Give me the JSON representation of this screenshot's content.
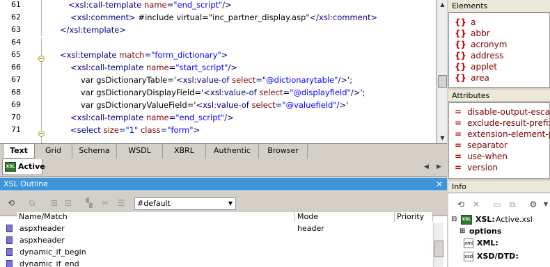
{
  "editor": {
    "lines": [
      {
        "num": "61",
        "parts": [
          {
            "c": "tg",
            "t": "<xsl:call-template "
          },
          {
            "c": "at",
            "t": "name"
          },
          {
            "c": "tg",
            "t": "="
          },
          {
            "c": "vl",
            "t": "\"end_script\""
          },
          {
            "c": "tg",
            "t": "/>"
          }
        ]
      },
      {
        "num": "62",
        "parts": [
          {
            "c": "tg",
            "t": "<xsl:comment>"
          },
          {
            "c": "tx",
            "t": " #include virtual=\"inc_partner_display.asp\""
          },
          {
            "c": "tg",
            "t": "</xsl:comment>"
          }
        ]
      },
      {
        "num": "63",
        "parts": [
          {
            "c": "tg",
            "t": "</xsl:template>"
          }
        ]
      },
      {
        "num": "64",
        "parts": []
      },
      {
        "num": "65",
        "parts": [
          {
            "c": "tg",
            "t": "<xsl:template "
          },
          {
            "c": "at",
            "t": "match"
          },
          {
            "c": "tg",
            "t": "="
          },
          {
            "c": "vl",
            "t": "\"form_dictionary\""
          },
          {
            "c": "tg",
            "t": ">"
          }
        ]
      },
      {
        "num": "66",
        "parts": [
          {
            "c": "tg",
            "t": "<xsl:call-template "
          },
          {
            "c": "at",
            "t": "name"
          },
          {
            "c": "tg",
            "t": "="
          },
          {
            "c": "vl",
            "t": "\"start_script\""
          },
          {
            "c": "tg",
            "t": "/>"
          }
        ]
      },
      {
        "num": "67",
        "parts": [
          {
            "c": "tx",
            "t": "var gsDictionaryTable='"
          },
          {
            "c": "tg",
            "t": "<xsl:value-of "
          },
          {
            "c": "at",
            "t": "select"
          },
          {
            "c": "tg",
            "t": "="
          },
          {
            "c": "vl",
            "t": "\"@dictionarytable\""
          },
          {
            "c": "tg",
            "t": "/>"
          },
          {
            "c": "tx",
            "t": "';"
          }
        ]
      },
      {
        "num": "68",
        "parts": [
          {
            "c": "tx",
            "t": "var gsDictionaryDisplayField='"
          },
          {
            "c": "tg",
            "t": "<xsl:value-of "
          },
          {
            "c": "at",
            "t": "select"
          },
          {
            "c": "tg",
            "t": "="
          },
          {
            "c": "vl",
            "t": "\"@displayfield\""
          },
          {
            "c": "tg",
            "t": "/>"
          },
          {
            "c": "tx",
            "t": "';"
          }
        ]
      },
      {
        "num": "69",
        "parts": [
          {
            "c": "tx",
            "t": "var gsDictionaryValueField='"
          },
          {
            "c": "tg",
            "t": "<xsl:value-of "
          },
          {
            "c": "at",
            "t": "select"
          },
          {
            "c": "tg",
            "t": "="
          },
          {
            "c": "vl",
            "t": "\"@valuefield\""
          },
          {
            "c": "tg",
            "t": "/>"
          },
          {
            "c": "tx",
            "t": "'"
          }
        ]
      },
      {
        "num": "70",
        "parts": [
          {
            "c": "tg",
            "t": "<xsl:call-template "
          },
          {
            "c": "at",
            "t": "name"
          },
          {
            "c": "tg",
            "t": "="
          },
          {
            "c": "vl",
            "t": "\"end_script\""
          },
          {
            "c": "tg",
            "t": "/>"
          }
        ]
      },
      {
        "num": "71",
        "parts": [
          {
            "c": "tg",
            "t": "<select "
          },
          {
            "c": "at",
            "t": "size"
          },
          {
            "c": "tg",
            "t": "="
          },
          {
            "c": "vl",
            "t": "\"1\""
          },
          {
            "c": "tg",
            "t": " "
          },
          {
            "c": "at",
            "t": "class"
          },
          {
            "c": "tg",
            "t": "="
          },
          {
            "c": "vl",
            "t": "\"form\""
          },
          {
            "c": "tg",
            "t": ">"
          }
        ]
      }
    ]
  },
  "view_tabs": [
    "Text",
    "Grid",
    "Schema",
    "WSDL",
    "XBRL",
    "Authentic",
    "Browser"
  ],
  "doc_tab": {
    "label": "Active"
  },
  "outline": {
    "title": "XSL Outline",
    "mode_value": "#default",
    "columns": [
      "Name/Match",
      "Mode",
      "Priority"
    ],
    "rows": [
      {
        "name": "aspxheader",
        "mode": "header"
      },
      {
        "name": "aspxheader",
        "mode": ""
      },
      {
        "name": "dynamic_if_begin",
        "mode": ""
      },
      {
        "name": "dynamic_if_end",
        "mode": ""
      }
    ]
  },
  "elements_panel": {
    "title": "Elements",
    "items": [
      "a",
      "abbr",
      "acronym",
      "address",
      "applet",
      "area"
    ]
  },
  "attributes_panel": {
    "title": "Attributes",
    "items": [
      "disable-output-escap",
      "exclude-result-prefixe",
      "extension-element-pr",
      "separator",
      "use-when",
      "version"
    ]
  },
  "info_panel": {
    "title": "Info",
    "xsl_label": "XSL:",
    "xsl_file": "Active.xsl",
    "options_label": "options",
    "xml_label": "XML:",
    "xsd_label": "XSD/DTD:"
  }
}
